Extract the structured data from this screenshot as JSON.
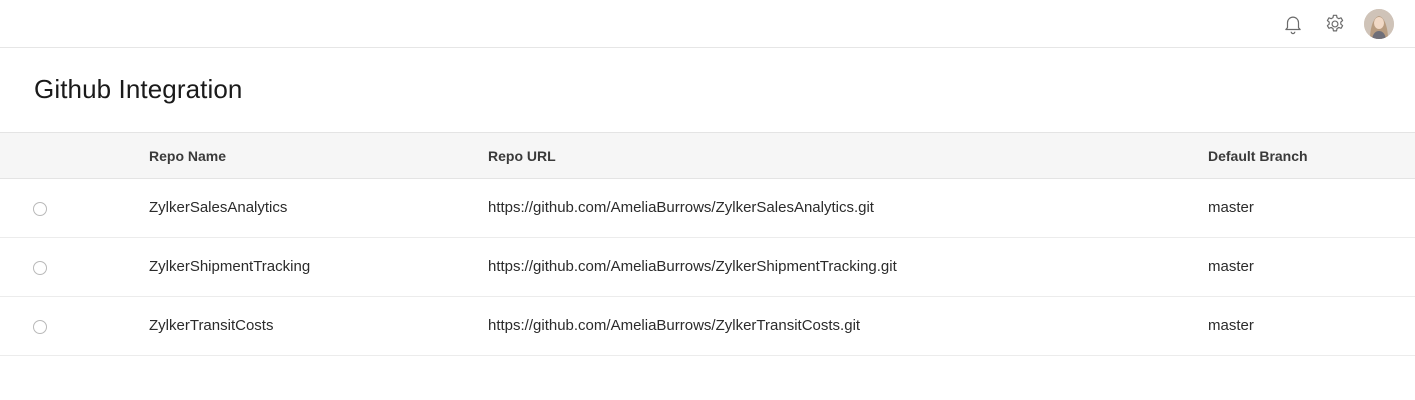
{
  "topbar": {
    "icons": [
      "bell-icon",
      "gear-icon",
      "avatar"
    ]
  },
  "page": {
    "title": "Github Integration"
  },
  "table": {
    "columns": [
      "Repo Name",
      "Repo URL",
      "Default Branch"
    ],
    "rows": [
      {
        "name": "ZylkerSalesAnalytics",
        "url": "https://github.com/AmeliaBurrows/ZylkerSalesAnalytics.git",
        "branch": "master"
      },
      {
        "name": "ZylkerShipmentTracking",
        "url": "https://github.com/AmeliaBurrows/ZylkerShipmentTracking.git",
        "branch": "master"
      },
      {
        "name": "ZylkerTransitCosts",
        "url": "https://github.com/AmeliaBurrows/ZylkerTransitCosts.git",
        "branch": "master"
      }
    ]
  }
}
